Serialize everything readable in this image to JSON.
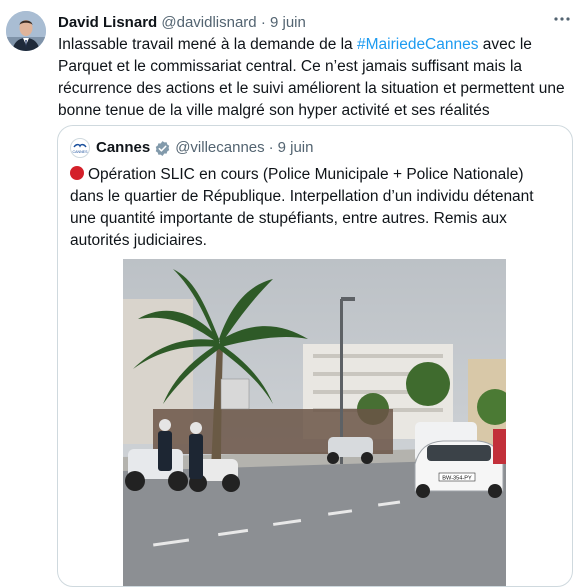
{
  "tweet": {
    "author_name": "David Lisnard",
    "handle": "@davidlisnard",
    "separator": "·",
    "date": "9 juin",
    "text_before_tag": "Inlassable travail mené à la demande de la ",
    "hashtag": "#MairiedeCannes",
    "text_after_tag": " avec le Parquet et le commissariat central. Ce n’est jamais suffisant mais la récurrence des actions et le suivi améliorent la situation et permettent une bonne tenue de la ville malgré son hyper activité et ses réalités",
    "more_icon": "more-horizontal-icon"
  },
  "quoted": {
    "author_name": "Cannes",
    "handle": "@villecannes",
    "separator": "·",
    "date": "9 juin",
    "text": "Opération SLIC en cours (Police Municipale + Police Nationale) dans le quartier de République. Interpellation d’un individu détenant une quantité importante de stupéfiants, entre autres. Remis aux autorités judiciaires.",
    "logo_text": "CANNES",
    "plate_text": "BW-354-PY"
  },
  "colors": {
    "link": "#1d9bf0",
    "verified_badge": "#829aab",
    "red_dot": "#d4202a",
    "border": "#cfd9de"
  }
}
